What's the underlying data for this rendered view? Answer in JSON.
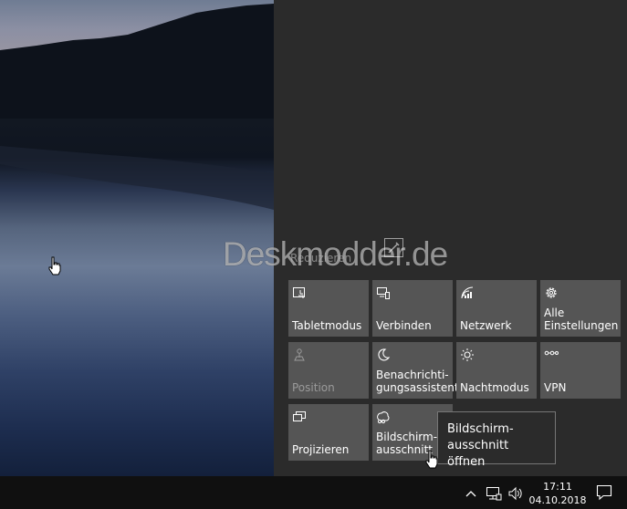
{
  "action_center": {
    "collapse_label": "Reduzieren",
    "tiles": [
      {
        "label": "Tabletmodus",
        "icon": "tablet-mode-icon",
        "enabled": true
      },
      {
        "label": "Verbinden",
        "icon": "connect-icon",
        "enabled": true
      },
      {
        "label": "Netzwerk",
        "icon": "network-icon",
        "enabled": true
      },
      {
        "label": "Alle\nEinstellungen",
        "icon": "gear-icon",
        "enabled": true
      },
      {
        "label": "Position",
        "icon": "location-icon",
        "enabled": false
      },
      {
        "label": "Benachrichti-\ngungsassistent",
        "icon": "moon-icon",
        "enabled": true
      },
      {
        "label": "Nachtmodus",
        "icon": "brightness-icon",
        "enabled": true
      },
      {
        "label": "VPN",
        "icon": "vpn-icon",
        "enabled": true
      },
      {
        "label": "Projizieren",
        "icon": "project-icon",
        "enabled": true
      },
      {
        "label": "Bildschirm-\nausschnitt",
        "icon": "snip-icon",
        "enabled": true
      }
    ],
    "tooltip": "Bildschirm-\nausschnitt öffnen"
  },
  "watermark": "Deskmodder.de",
  "taskbar": {
    "time": "17:11",
    "date": "04.10.2018",
    "tray_icons": [
      "chevron-up-icon",
      "network-wired-icon",
      "volume-icon"
    ],
    "notification_icon": "notification-center-icon"
  }
}
